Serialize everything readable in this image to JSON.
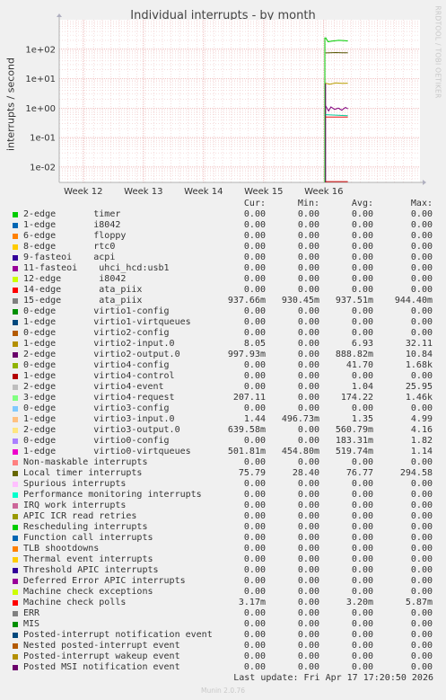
{
  "chart_data": {
    "type": "line",
    "title": "Individual interrupts - by month",
    "ylabel": "interrupts / second",
    "yscale": "log",
    "ylim": [
      0.003,
      1000
    ],
    "y_ticks": [
      "1e-02",
      "1e-01",
      "1e+00",
      "1e+01",
      "1e+02"
    ],
    "y_tick_values": [
      0.01,
      0.1,
      1,
      10,
      100
    ],
    "x_ticks": [
      "Week 12",
      "Week 13",
      "Week 14",
      "Week 15",
      "Week 16"
    ],
    "xlim": [
      0,
      60
    ],
    "x_tick_values": [
      4,
      14,
      24,
      34,
      44
    ],
    "grid": true,
    "series": [
      {
        "name": "15-edge",
        "color": "#00cc00",
        "points": [
          [
            44.3,
            250
          ],
          [
            44.7,
            180
          ],
          [
            45.5,
            190
          ],
          [
            46.5,
            200
          ],
          [
            47.5,
            195
          ],
          [
            48.0,
            190
          ]
        ]
      },
      {
        "name": "Local timer interrupts",
        "color": "#555500",
        "points": [
          [
            44.3,
            75
          ],
          [
            45.0,
            76
          ],
          [
            46.0,
            77
          ],
          [
            47.0,
            76
          ],
          [
            48.0,
            76
          ]
        ]
      },
      {
        "name": "1-edge virtio2-input.0",
        "color": "#b89c00",
        "points": [
          [
            44.3,
            7
          ],
          [
            45.0,
            6.5
          ],
          [
            46.0,
            7.2
          ],
          [
            47.0,
            6.9
          ],
          [
            48.0,
            7.0
          ]
        ]
      },
      {
        "name": "2-edge virtio2-output.0",
        "color": "#7f007f",
        "points": [
          [
            44.3,
            1.2
          ],
          [
            44.8,
            0.8
          ],
          [
            45.2,
            1.1
          ],
          [
            45.8,
            0.9
          ],
          [
            46.4,
            1.0
          ],
          [
            47.0,
            0.85
          ],
          [
            47.6,
            1.05
          ],
          [
            48.0,
            0.95
          ]
        ]
      },
      {
        "name": "12-edge i8042",
        "color": "#00cc99",
        "points": [
          [
            44.3,
            0.6
          ],
          [
            48.0,
            0.55
          ]
        ]
      },
      {
        "name": "14-edge ata_piix",
        "color": "#ee1111",
        "points": [
          [
            44.3,
            0.5
          ],
          [
            48.0,
            0.5
          ]
        ]
      },
      {
        "name": "Machine check polls",
        "color": "#cc0000",
        "points": [
          [
            44.3,
            0.0032
          ],
          [
            48.0,
            0.0032
          ]
        ]
      }
    ],
    "legend_placement": "below",
    "columns": [
      "Cur:",
      "Min:",
      "Avg:",
      "Max:"
    ],
    "rows": [
      {
        "label": "2-edge       timer",
        "color": "#00cc00",
        "cur": "0.00",
        "min": "0.00",
        "avg": "0.00",
        "max": "0.00"
      },
      {
        "label": "1-edge       i8042",
        "color": "#0066b3",
        "cur": "0.00",
        "min": "0.00",
        "avg": "0.00",
        "max": "0.00"
      },
      {
        "label": "6-edge       floppy",
        "color": "#ff8000",
        "cur": "0.00",
        "min": "0.00",
        "avg": "0.00",
        "max": "0.00"
      },
      {
        "label": "8-edge       rtc0",
        "color": "#ffcc00",
        "cur": "0.00",
        "min": "0.00",
        "avg": "0.00",
        "max": "0.00"
      },
      {
        "label": "9-fasteoi    acpi",
        "color": "#330099",
        "cur": "0.00",
        "min": "0.00",
        "avg": "0.00",
        "max": "0.00"
      },
      {
        "label": "11-fasteoi    uhci_hcd:usb1",
        "color": "#990099",
        "cur": "0.00",
        "min": "0.00",
        "avg": "0.00",
        "max": "0.00"
      },
      {
        "label": "12-edge       i8042",
        "color": "#ccff00",
        "cur": "0.00",
        "min": "0.00",
        "avg": "0.00",
        "max": "0.00"
      },
      {
        "label": "14-edge       ata_piix",
        "color": "#ff0000",
        "cur": "0.00",
        "min": "0.00",
        "avg": "0.00",
        "max": "0.00"
      },
      {
        "label": "15-edge       ata_piix",
        "color": "#808080",
        "cur": "937.66m",
        "min": "930.45m",
        "avg": "937.51m",
        "max": "944.40m"
      },
      {
        "label": "0-edge       virtio1-config",
        "color": "#008f00",
        "cur": "0.00",
        "min": "0.00",
        "avg": "0.00",
        "max": "0.00"
      },
      {
        "label": "1-edge       virtio1-virtqueues",
        "color": "#00487d",
        "cur": "0.00",
        "min": "0.00",
        "avg": "0.00",
        "max": "0.00"
      },
      {
        "label": "0-edge       virtio2-config",
        "color": "#b35a00",
        "cur": "0.00",
        "min": "0.00",
        "avg": "0.00",
        "max": "0.00"
      },
      {
        "label": "1-edge       virtio2-input.0",
        "color": "#b38f00",
        "cur": "8.05",
        "min": "0.00",
        "avg": "6.93",
        "max": "32.11"
      },
      {
        "label": "2-edge       virtio2-output.0",
        "color": "#6b006b",
        "cur": "997.93m",
        "min": "0.00",
        "avg": "888.82m",
        "max": "10.84"
      },
      {
        "label": "0-edge       virtio4-config",
        "color": "#8fb300",
        "cur": "0.00",
        "min": "0.00",
        "avg": "41.70",
        "max": "1.68k"
      },
      {
        "label": "1-edge       virtio4-control",
        "color": "#b30000",
        "cur": "0.00",
        "min": "0.00",
        "avg": "0.00",
        "max": "0.00"
      },
      {
        "label": "2-edge       virtio4-event",
        "color": "#bebebe",
        "cur": "0.00",
        "min": "0.00",
        "avg": "1.04",
        "max": "25.95"
      },
      {
        "label": "3-edge       virtio4-request",
        "color": "#80ff80",
        "cur": "207.11",
        "min": "0.00",
        "avg": "174.22",
        "max": "1.46k"
      },
      {
        "label": "0-edge       virtio3-config",
        "color": "#80c9ff",
        "cur": "0.00",
        "min": "0.00",
        "avg": "0.00",
        "max": "0.00"
      },
      {
        "label": "1-edge       virtio3-input.0",
        "color": "#ffc080",
        "cur": "1.44",
        "min": "496.73m",
        "avg": "1.35",
        "max": "4.99"
      },
      {
        "label": "2-edge       virtio3-output.0",
        "color": "#ffe680",
        "cur": "639.58m",
        "min": "0.00",
        "avg": "560.79m",
        "max": "4.16"
      },
      {
        "label": "0-edge       virtio0-config",
        "color": "#aa80ff",
        "cur": "0.00",
        "min": "0.00",
        "avg": "183.31m",
        "max": "1.82"
      },
      {
        "label": "1-edge       virtio0-virtqueues",
        "color": "#ee00cc",
        "cur": "501.81m",
        "min": "454.80m",
        "avg": "519.74m",
        "max": "1.14"
      },
      {
        "label": "Non-maskable interrupts",
        "color": "#ff8080",
        "cur": "0.00",
        "min": "0.00",
        "avg": "0.00",
        "max": "0.00"
      },
      {
        "label": "Local timer interrupts",
        "color": "#666600",
        "cur": "75.79",
        "min": "28.40",
        "avg": "76.77",
        "max": "294.58"
      },
      {
        "label": "Spurious interrupts",
        "color": "#ffbfff",
        "cur": "0.00",
        "min": "0.00",
        "avg": "0.00",
        "max": "0.00"
      },
      {
        "label": "Performance monitoring interrupts",
        "color": "#00ffcc",
        "cur": "0.00",
        "min": "0.00",
        "avg": "0.00",
        "max": "0.00"
      },
      {
        "label": "IRQ work interrupts",
        "color": "#cc6699",
        "cur": "0.00",
        "min": "0.00",
        "avg": "0.00",
        "max": "0.00"
      },
      {
        "label": "APIC ICR read retries",
        "color": "#999900",
        "cur": "0.00",
        "min": "0.00",
        "avg": "0.00",
        "max": "0.00"
      },
      {
        "label": "Rescheduling interrupts",
        "color": "#00cc00",
        "cur": "0.00",
        "min": "0.00",
        "avg": "0.00",
        "max": "0.00"
      },
      {
        "label": "Function call interrupts",
        "color": "#0066b3",
        "cur": "0.00",
        "min": "0.00",
        "avg": "0.00",
        "max": "0.00"
      },
      {
        "label": "TLB shootdowns",
        "color": "#ff8000",
        "cur": "0.00",
        "min": "0.00",
        "avg": "0.00",
        "max": "0.00"
      },
      {
        "label": "Thermal event interrupts",
        "color": "#ffcc00",
        "cur": "0.00",
        "min": "0.00",
        "avg": "0.00",
        "max": "0.00"
      },
      {
        "label": "Threshold APIC interrupts",
        "color": "#330099",
        "cur": "0.00",
        "min": "0.00",
        "avg": "0.00",
        "max": "0.00"
      },
      {
        "label": "Deferred Error APIC interrupts",
        "color": "#990099",
        "cur": "0.00",
        "min": "0.00",
        "avg": "0.00",
        "max": "0.00"
      },
      {
        "label": "Machine check exceptions",
        "color": "#ccff00",
        "cur": "0.00",
        "min": "0.00",
        "avg": "0.00",
        "max": "0.00"
      },
      {
        "label": "Machine check polls",
        "color": "#ff0000",
        "cur": "3.17m",
        "min": "0.00",
        "avg": "3.20m",
        "max": "5.87m"
      },
      {
        "label": "ERR",
        "color": "#808080",
        "cur": "0.00",
        "min": "0.00",
        "avg": "0.00",
        "max": "0.00"
      },
      {
        "label": "MIS",
        "color": "#008f00",
        "cur": "0.00",
        "min": "0.00",
        "avg": "0.00",
        "max": "0.00"
      },
      {
        "label": "Posted-interrupt notification event",
        "color": "#00487d",
        "cur": "0.00",
        "min": "0.00",
        "avg": "0.00",
        "max": "0.00"
      },
      {
        "label": "Nested posted-interrupt event",
        "color": "#b35a00",
        "cur": "0.00",
        "min": "0.00",
        "avg": "0.00",
        "max": "0.00"
      },
      {
        "label": "Posted-interrupt wakeup event",
        "color": "#b38f00",
        "cur": "0.00",
        "min": "0.00",
        "avg": "0.00",
        "max": "0.00"
      },
      {
        "label": "Posted MSI notification event",
        "color": "#6b006b",
        "cur": "0.00",
        "min": "0.00",
        "avg": "0.00",
        "max": "0.00"
      }
    ]
  },
  "watermark": "RRDTOOL / TOBI OETIKER",
  "last_update": "Last update: Fri Apr 17 17:20:50 2026",
  "footer": "Munin 2.0.76"
}
